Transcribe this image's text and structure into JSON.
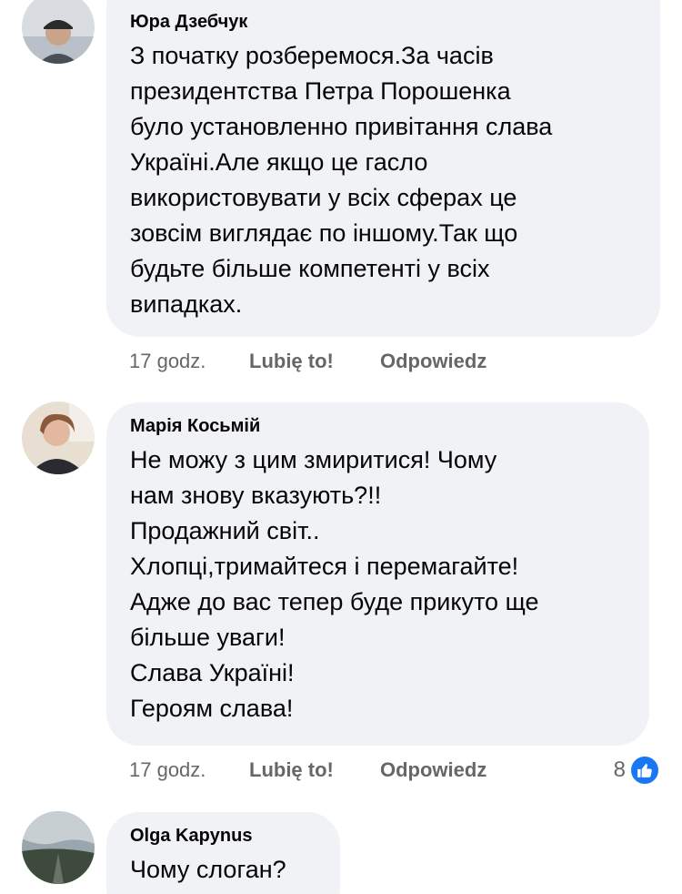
{
  "comments": [
    {
      "author": "Юра Дзебчук",
      "text": "З початку розберемося.За часів\nпрезидентства Петра Порошенка\nбуло установленно привітання слава\nУкраїні.Але якщо це гасло\nвикористовувати у всіх сферах це\nзовсім виглядає по іншому.Так що\nбудьте більше компетенті у всіх\nвипадках.",
      "time": "17 godz.",
      "like_label": "Lubię to!",
      "reply_label": "Odpowiedz"
    },
    {
      "author": "Марія Косьмій",
      "text": "Не можу з цим змиритися! Чому\nнам знову вказують?!!\nПродажний світ..\nХлопці,тримайтеся і перемагайте!\nАдже до вас тепер буде прикуто ще\nбільше уваги!\nСлава Україні!\nГероям слава!",
      "time": "17 godz.",
      "like_label": "Lubię to!",
      "reply_label": "Odpowiedz",
      "reaction_count": "8",
      "reaction_icon": "like-icon"
    },
    {
      "author": "Olga Kapynus",
      "text": "Чому слоган?"
    }
  ],
  "colors": {
    "bubble": "#f0f2f5",
    "meta_text": "#65676b",
    "like_blue": "#1877f2"
  }
}
